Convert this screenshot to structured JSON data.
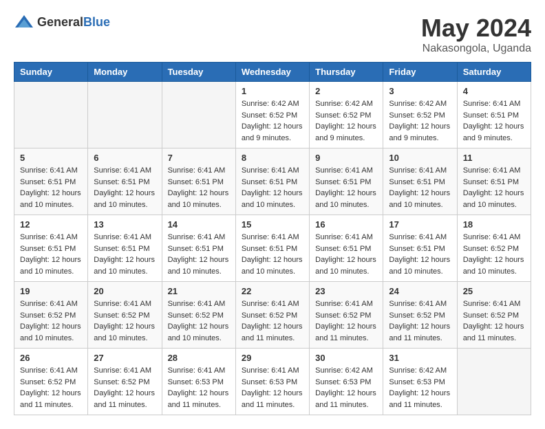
{
  "header": {
    "logo_general": "General",
    "logo_blue": "Blue",
    "month_title": "May 2024",
    "location": "Nakasongola, Uganda"
  },
  "days_of_week": [
    "Sunday",
    "Monday",
    "Tuesday",
    "Wednesday",
    "Thursday",
    "Friday",
    "Saturday"
  ],
  "weeks": [
    [
      {
        "day": "",
        "info": ""
      },
      {
        "day": "",
        "info": ""
      },
      {
        "day": "",
        "info": ""
      },
      {
        "day": "1",
        "info": "Sunrise: 6:42 AM\nSunset: 6:52 PM\nDaylight: 12 hours\nand 9 minutes."
      },
      {
        "day": "2",
        "info": "Sunrise: 6:42 AM\nSunset: 6:52 PM\nDaylight: 12 hours\nand 9 minutes."
      },
      {
        "day": "3",
        "info": "Sunrise: 6:42 AM\nSunset: 6:52 PM\nDaylight: 12 hours\nand 9 minutes."
      },
      {
        "day": "4",
        "info": "Sunrise: 6:41 AM\nSunset: 6:51 PM\nDaylight: 12 hours\nand 9 minutes."
      }
    ],
    [
      {
        "day": "5",
        "info": "Sunrise: 6:41 AM\nSunset: 6:51 PM\nDaylight: 12 hours\nand 10 minutes."
      },
      {
        "day": "6",
        "info": "Sunrise: 6:41 AM\nSunset: 6:51 PM\nDaylight: 12 hours\nand 10 minutes."
      },
      {
        "day": "7",
        "info": "Sunrise: 6:41 AM\nSunset: 6:51 PM\nDaylight: 12 hours\nand 10 minutes."
      },
      {
        "day": "8",
        "info": "Sunrise: 6:41 AM\nSunset: 6:51 PM\nDaylight: 12 hours\nand 10 minutes."
      },
      {
        "day": "9",
        "info": "Sunrise: 6:41 AM\nSunset: 6:51 PM\nDaylight: 12 hours\nand 10 minutes."
      },
      {
        "day": "10",
        "info": "Sunrise: 6:41 AM\nSunset: 6:51 PM\nDaylight: 12 hours\nand 10 minutes."
      },
      {
        "day": "11",
        "info": "Sunrise: 6:41 AM\nSunset: 6:51 PM\nDaylight: 12 hours\nand 10 minutes."
      }
    ],
    [
      {
        "day": "12",
        "info": "Sunrise: 6:41 AM\nSunset: 6:51 PM\nDaylight: 12 hours\nand 10 minutes."
      },
      {
        "day": "13",
        "info": "Sunrise: 6:41 AM\nSunset: 6:51 PM\nDaylight: 12 hours\nand 10 minutes."
      },
      {
        "day": "14",
        "info": "Sunrise: 6:41 AM\nSunset: 6:51 PM\nDaylight: 12 hours\nand 10 minutes."
      },
      {
        "day": "15",
        "info": "Sunrise: 6:41 AM\nSunset: 6:51 PM\nDaylight: 12 hours\nand 10 minutes."
      },
      {
        "day": "16",
        "info": "Sunrise: 6:41 AM\nSunset: 6:51 PM\nDaylight: 12 hours\nand 10 minutes."
      },
      {
        "day": "17",
        "info": "Sunrise: 6:41 AM\nSunset: 6:51 PM\nDaylight: 12 hours\nand 10 minutes."
      },
      {
        "day": "18",
        "info": "Sunrise: 6:41 AM\nSunset: 6:52 PM\nDaylight: 12 hours\nand 10 minutes."
      }
    ],
    [
      {
        "day": "19",
        "info": "Sunrise: 6:41 AM\nSunset: 6:52 PM\nDaylight: 12 hours\nand 10 minutes."
      },
      {
        "day": "20",
        "info": "Sunrise: 6:41 AM\nSunset: 6:52 PM\nDaylight: 12 hours\nand 10 minutes."
      },
      {
        "day": "21",
        "info": "Sunrise: 6:41 AM\nSunset: 6:52 PM\nDaylight: 12 hours\nand 10 minutes."
      },
      {
        "day": "22",
        "info": "Sunrise: 6:41 AM\nSunset: 6:52 PM\nDaylight: 12 hours\nand 11 minutes."
      },
      {
        "day": "23",
        "info": "Sunrise: 6:41 AM\nSunset: 6:52 PM\nDaylight: 12 hours\nand 11 minutes."
      },
      {
        "day": "24",
        "info": "Sunrise: 6:41 AM\nSunset: 6:52 PM\nDaylight: 12 hours\nand 11 minutes."
      },
      {
        "day": "25",
        "info": "Sunrise: 6:41 AM\nSunset: 6:52 PM\nDaylight: 12 hours\nand 11 minutes."
      }
    ],
    [
      {
        "day": "26",
        "info": "Sunrise: 6:41 AM\nSunset: 6:52 PM\nDaylight: 12 hours\nand 11 minutes."
      },
      {
        "day": "27",
        "info": "Sunrise: 6:41 AM\nSunset: 6:52 PM\nDaylight: 12 hours\nand 11 minutes."
      },
      {
        "day": "28",
        "info": "Sunrise: 6:41 AM\nSunset: 6:53 PM\nDaylight: 12 hours\nand 11 minutes."
      },
      {
        "day": "29",
        "info": "Sunrise: 6:41 AM\nSunset: 6:53 PM\nDaylight: 12 hours\nand 11 minutes."
      },
      {
        "day": "30",
        "info": "Sunrise: 6:42 AM\nSunset: 6:53 PM\nDaylight: 12 hours\nand 11 minutes."
      },
      {
        "day": "31",
        "info": "Sunrise: 6:42 AM\nSunset: 6:53 PM\nDaylight: 12 hours\nand 11 minutes."
      },
      {
        "day": "",
        "info": ""
      }
    ]
  ]
}
